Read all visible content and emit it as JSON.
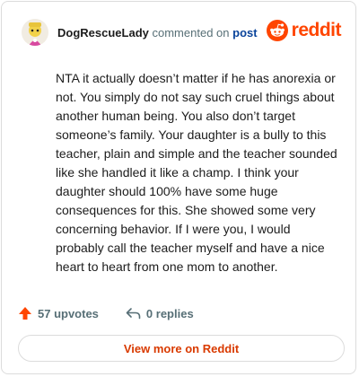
{
  "header": {
    "username": "DogRescueLady",
    "verb": "commented on",
    "post_link": "post"
  },
  "brand": {
    "wordmark": "reddit",
    "color": "#ff4500"
  },
  "comment": {
    "text": "NTA it actually doesn’t matter if he has anorexia or not. You simply do not say such cruel things about another human being. You also don’t target someone’s family. Your daughter is a bully to this teacher, plain and simple and the teacher sounded like she handled it like a champ. I think your daughter should 100% have some huge consequences for this. She showed some very concerning behavior. If I were you, I would probably call the teacher myself and have a nice heart to heart from one mom to another."
  },
  "actions": {
    "upvotes": "57 upvotes",
    "replies": "0 replies",
    "upvote_icon": "upvote-arrow-icon",
    "reply_icon": "reply-arrow-icon"
  },
  "footer": {
    "view_more": "View more on Reddit"
  },
  "colors": {
    "accent": "#ff4500",
    "link": "#0a449b",
    "muted": "#576f76",
    "view_more": "#d93a00"
  }
}
